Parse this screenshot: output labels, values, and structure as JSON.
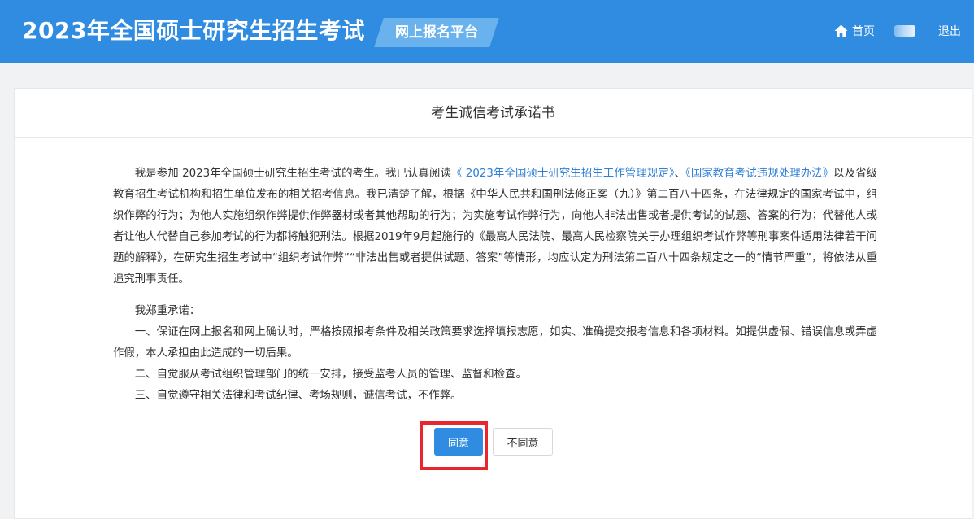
{
  "header": {
    "title": "2023年全国硕士研究生招生考试",
    "platform": "网上报名平台",
    "home_label": "首页",
    "logout_label": "退出",
    "icons": {
      "home": "home-icon"
    },
    "colors": {
      "bar": "#2f8ce0",
      "tag": "#6ab2ee"
    }
  },
  "pledge": {
    "title": "考生诚信考试承诺书",
    "intro_prefix": "我是参加 2023年全国硕士研究生招生考试的考生。我已认真阅读",
    "link1": "《 2023年全国硕士研究生招生工作管理规定》",
    "sep": "、",
    "link2": "《国家教育考试违规处理办法》",
    "intro_suffix": "以及省级教育招生考试机构和招生单位发布的相关招考信息。我已清楚了解，根据《中华人民共和国刑法修正案（九）》第二百八十四条，在法律规定的国家考试中，组织作弊的行为；为他人实施组织作弊提供作弊器材或者其他帮助的行为；为实施考试作弊行为，向他人非法出售或者提供考试的试题、答案的行为；代替他人或者让他人代替自己参加考试的行为都将触犯刑法。根据2019年9月起施行的《最高人民法院、最高人民检察院关于办理组织考试作弊等刑事案件适用法律若干问题的解释》，在研究生招生考试中“组织考试作弊”“非法出售或者提供试题、答案”等情形，均应认定为刑法第二百八十四条规定之一的“情节严重”，将依法从重追究刑事责任。",
    "solemn": "我郑重承诺：",
    "item1": "一、保证在网上报名和网上确认时，严格按照报考条件及相关政策要求选择填报志愿，如实、准确提交报考信息和各项材料。如提供虚假、错误信息或弄虚作假，本人承担由此造成的一切后果。",
    "item2": "二、自觉服从考试组织管理部门的统一安排，接受监考人员的管理、监督和检查。",
    "item3": "三、自觉遵守相关法律和考试纪律、考场规则，诚信考试，不作弊。",
    "agree_label": "同意",
    "disagree_label": "不同意",
    "colors": {
      "link": "#2f7fd6",
      "primary": "#2f8ce0",
      "highlight": "#e8262d"
    }
  }
}
